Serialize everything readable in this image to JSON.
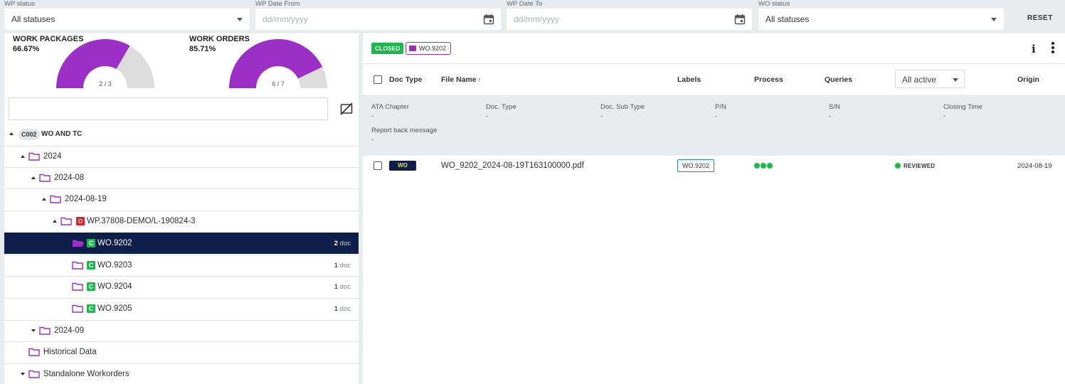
{
  "filters": {
    "wp_status": {
      "label": "WP status",
      "value": "All statuses"
    },
    "wp_date_from": {
      "label": "WP Date From",
      "placeholder": "dd/mm/yyyy"
    },
    "wp_date_to": {
      "label": "WP Date To",
      "placeholder": "dd/mm/yyyy"
    },
    "wo_status": {
      "label": "WO status",
      "value": "All statuses"
    },
    "reset_label": "RESET"
  },
  "gauges": [
    {
      "title": "WORK PACKAGES",
      "percent": "66.67%",
      "ratio": "2 / 3",
      "fraction": 0.6667,
      "color": "#9b2fc6"
    },
    {
      "title": "WORK ORDERS",
      "percent": "85.71%",
      "ratio": "6 / 7",
      "fraction": 0.8571,
      "color": "#9b2fc6"
    }
  ],
  "tree": {
    "root_code": "C002",
    "root_label": "WO AND TC",
    "items": [
      {
        "label": "2024"
      },
      {
        "label": "2024-08"
      },
      {
        "label": "2024-08-19"
      },
      {
        "label": "WP.37808-DEMO/L-190824-3"
      },
      {
        "label": "WO.9202",
        "badge": "C",
        "count": "2",
        "unit": "doc"
      },
      {
        "label": "WO.9203",
        "badge": "C",
        "count": "1",
        "unit": "doc"
      },
      {
        "label": "WO.9204",
        "badge": "C",
        "count": "1",
        "unit": "doc"
      },
      {
        "label": "WO.9205",
        "badge": "C",
        "count": "1",
        "unit": "doc"
      },
      {
        "label": "2024-09"
      },
      {
        "label": "Historical Data"
      },
      {
        "label": "Standalone Workorders"
      }
    ]
  },
  "right": {
    "status_badge": "CLOSED",
    "wo_chip": "WO.9202",
    "info_glyph": "i",
    "columns": {
      "doc_type": "Doc Type",
      "file_name": "File Name",
      "labels": "Labels",
      "process": "Process",
      "queries": "Queries",
      "filter_value": "All active",
      "origin": "Origin",
      "arrow_up": "↑"
    },
    "details": {
      "ata_chapter": {
        "label": "ATA Chapter",
        "value": "-"
      },
      "doc_type": {
        "label": "Doc. Type",
        "value": "-"
      },
      "doc_sub_type": {
        "label": "Doc. Sub Type",
        "value": "-"
      },
      "pn": {
        "label": "P/N",
        "value": "-"
      },
      "sn": {
        "label": "S/N",
        "value": "-"
      },
      "closing_time": {
        "label": "Closing Time",
        "value": "-"
      },
      "report_back": {
        "label": "Report back message",
        "value": "-"
      }
    },
    "row": {
      "doc_type_tag": "WO",
      "file_name": "WO_9202_2024-08-19T163100000.pdf",
      "label_chip": "WO.9202",
      "status": "REVIEWED",
      "origin": "2024-08-19"
    }
  },
  "colors": {
    "accent_purple": "#9b2fc6",
    "selected_navy": "#0f1f4b",
    "status_green": "#1db84c",
    "open_red": "#d9232e"
  }
}
